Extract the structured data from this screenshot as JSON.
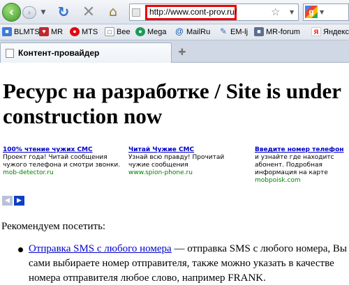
{
  "browser": {
    "url": "http://www.cont-prov.ru/",
    "tab_title": "Контент-провайдер",
    "bookmarks": [
      "BLMTS",
      "MR",
      "MTS",
      "Bee",
      "Mega",
      "MailRu",
      "EM-lj",
      "MR-forum",
      "Яндекс"
    ]
  },
  "page": {
    "heading": "Ресурс на разработке / Site is under construction now",
    "ads": [
      {
        "title": "100% чтение чужих СМС",
        "desc": "Проект года! Читай сообщения чужого телефона и смотри звонки.",
        "url": "mob-detector.ru"
      },
      {
        "title": "Читай Чужие СМС",
        "desc": "Узнай всю правду! Прочитай чужие сообщения",
        "url": "www.spion-phone.ru"
      },
      {
        "title": "Введите номер телефон",
        "desc": "и узнайте где находитс абонент. Подробная информация на карте",
        "url": "mobpoisk.com"
      }
    ],
    "recommend": "Рекомендуем посетить:",
    "item_link": "Отправка SMS с любого номера",
    "item_text": " — отправка SMS с любого номера, Вы сами выбираете номер отправителя, также можно указать в качестве номера отправителя любое слово, например FRANK."
  }
}
